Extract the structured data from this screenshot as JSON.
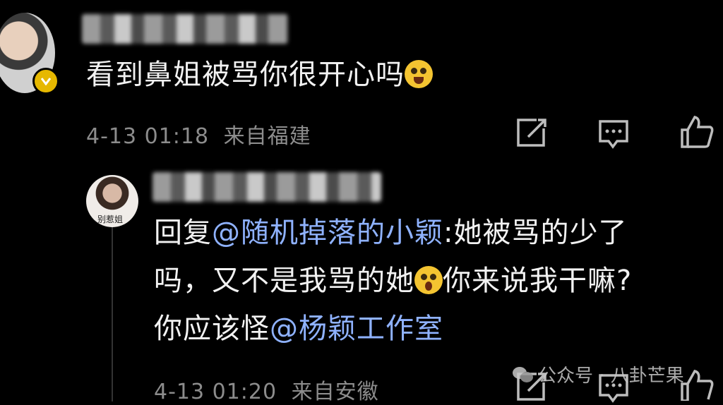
{
  "comment": {
    "text": "看到鼻姐被骂你很开心吗",
    "time": "4-13 01:18",
    "location": "来自福建",
    "emoji": "laughing-emoji"
  },
  "reply": {
    "prefix": "回复",
    "mention1": "@随机掉落的小颖",
    "text1": ":她被骂的少了",
    "text2": "吗，又不是我骂的她",
    "text3": "你来说我干嘛?",
    "text4": "你应该怪",
    "mention2": "@杨颖工作室",
    "time": "4-13 01:20",
    "location": "来自安徽",
    "avatar_label": "别惹姐",
    "emoji": "shocked-emoji"
  },
  "watermark": {
    "label": "公众号 · 八卦芒果"
  },
  "colors": {
    "background": "#000000",
    "mention": "#8fb2ff",
    "meta": "#8c8c8c",
    "badge": "#e6b800"
  }
}
